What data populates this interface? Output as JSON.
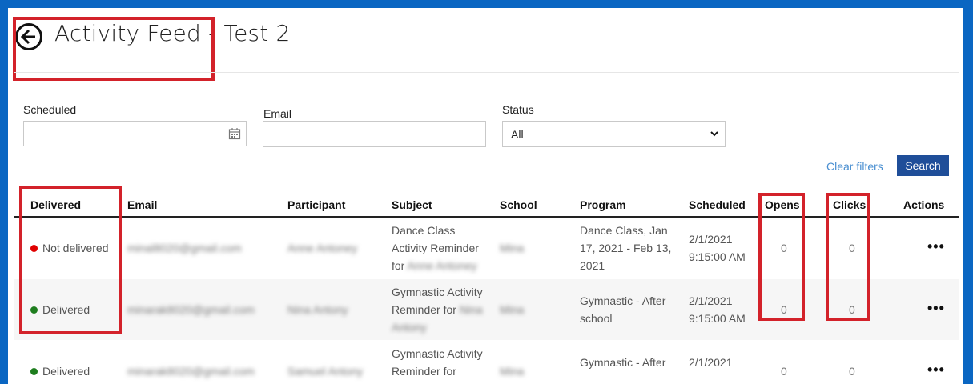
{
  "header": {
    "title": "Activity Feed - Test 2"
  },
  "filters": {
    "scheduled_label": "Scheduled",
    "email_label": "Email",
    "status_label": "Status",
    "status_value": "All",
    "clear_filters": "Clear filters",
    "search_button": "Search"
  },
  "table": {
    "columns": [
      "Delivered",
      "Email",
      "Participant",
      "Subject",
      "School",
      "Program",
      "Scheduled",
      "Opens",
      "Clicks",
      "Actions"
    ],
    "rows": [
      {
        "delivered": "Not delivered",
        "status_color": "#e00000",
        "email": "minal8020@gmail.com",
        "participant": "Anne Antoney",
        "subject_line1": "Dance Class",
        "subject_line2": "Activity Reminder",
        "subject_line3_prefix": "for",
        "subject_line3_name": "Anne Antoney",
        "school": "Mina",
        "program_line1": "Dance Class, Jan",
        "program_line2": "17, 2021 - Feb 13,",
        "program_line3": "2021",
        "scheduled_date": "2/1/2021",
        "scheduled_time": "9:15:00 AM",
        "opens": "0",
        "clicks": "0",
        "actions": "•••"
      },
      {
        "delivered": "Delivered",
        "status_color": "#1e7d1e",
        "email": "minarak8020@gmail.com",
        "participant": "Nina Antony",
        "subject_line1": "Gymnastic Activity",
        "subject_line2_prefix": "Reminder for",
        "subject_line2_name": "Nina",
        "subject_line3_name": "Antony",
        "school": "Mina",
        "program_line1": "Gymnastic - After",
        "program_line2": "school",
        "scheduled_date": "2/1/2021",
        "scheduled_time": "9:15:00 AM",
        "opens": "0",
        "clicks": "0",
        "actions": "•••"
      },
      {
        "delivered": "Delivered",
        "status_color": "#1e7d1e",
        "email": "minarak8020@gmail.com",
        "participant": "Samuel Antony",
        "subject_line1": "Gymnastic Activity",
        "subject_line2": "Reminder for",
        "school": "Mina",
        "program_line1": "Gymnastic - After",
        "scheduled_date": "2/1/2021",
        "opens": "0",
        "clicks": "0",
        "actions": "•••"
      }
    ]
  },
  "colors": {
    "highlight": "#d3222a",
    "accent": "#1f4e99",
    "link": "#4a8fd1",
    "frame": "#0a66c2"
  }
}
